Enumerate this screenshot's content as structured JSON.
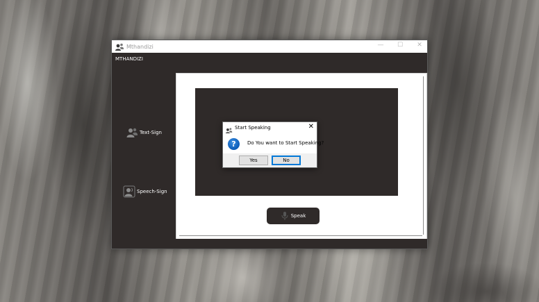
{
  "window": {
    "title": "Mthandizi",
    "controls": {
      "minimize": "—",
      "maximize": "☐",
      "close": "✕"
    }
  },
  "menubar": {
    "label": "MTHANDIZI"
  },
  "sidebar": {
    "items": [
      {
        "label": "Text-Sign",
        "icon": "users-icon"
      },
      {
        "label": "Speech-Sign",
        "icon": "speech-user-icon"
      }
    ]
  },
  "main": {
    "speak_button": {
      "label": "Speak",
      "icon": "microphone-icon"
    }
  },
  "dialog": {
    "title": "Start Speaking",
    "close": "✕",
    "icon_glyph": "?",
    "message": "Do You want to Start Speaking?",
    "yes_label": "Yes",
    "no_label": "No"
  },
  "colors": {
    "window_bg": "#2f2a29",
    "panel_bg": "#ffffff",
    "question_icon": "#0b5cb8",
    "default_button_border": "#0078d7"
  }
}
